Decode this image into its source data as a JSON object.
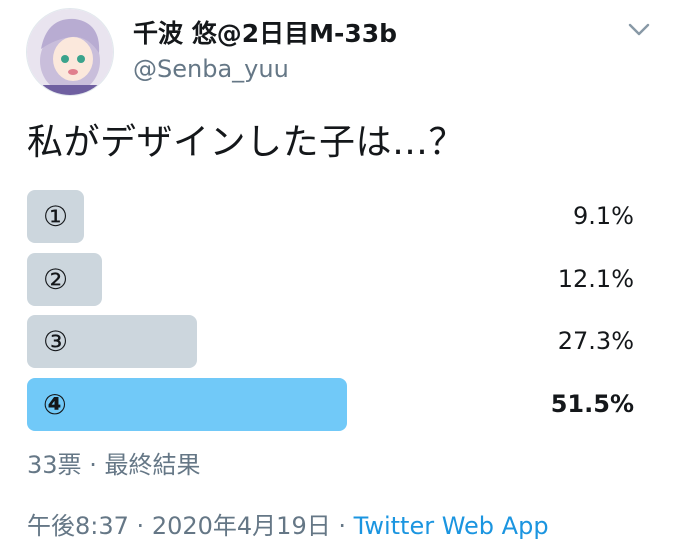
{
  "user": {
    "display_name": "千波 悠@2日目M-33b",
    "handle": "@Senba_yuu"
  },
  "tweet": {
    "text": "私がデザインした子は…？"
  },
  "poll": {
    "options": [
      {
        "label": "①",
        "percent_text": "9.1%",
        "percent": 9.1,
        "winner": false
      },
      {
        "label": "②",
        "percent_text": "12.1%",
        "percent": 12.1,
        "winner": false
      },
      {
        "label": "③",
        "percent_text": "27.3%",
        "percent": 27.3,
        "winner": false
      },
      {
        "label": "④",
        "percent_text": "51.5%",
        "percent": 51.5,
        "winner": true
      }
    ],
    "votes_text": "33票",
    "separator": "·",
    "status_text": "最終結果"
  },
  "footer": {
    "time": "午後8:37",
    "separator": "·",
    "date": "2020年4月19日",
    "source": "Twitter Web App"
  },
  "colors": {
    "bar_default": "#ccd6dd",
    "bar_winner": "#71c9f8",
    "secondary_text": "#657786",
    "link": "#1b95e0"
  },
  "icons": {
    "caret": "chevron-down-icon",
    "avatar": "avatar"
  }
}
